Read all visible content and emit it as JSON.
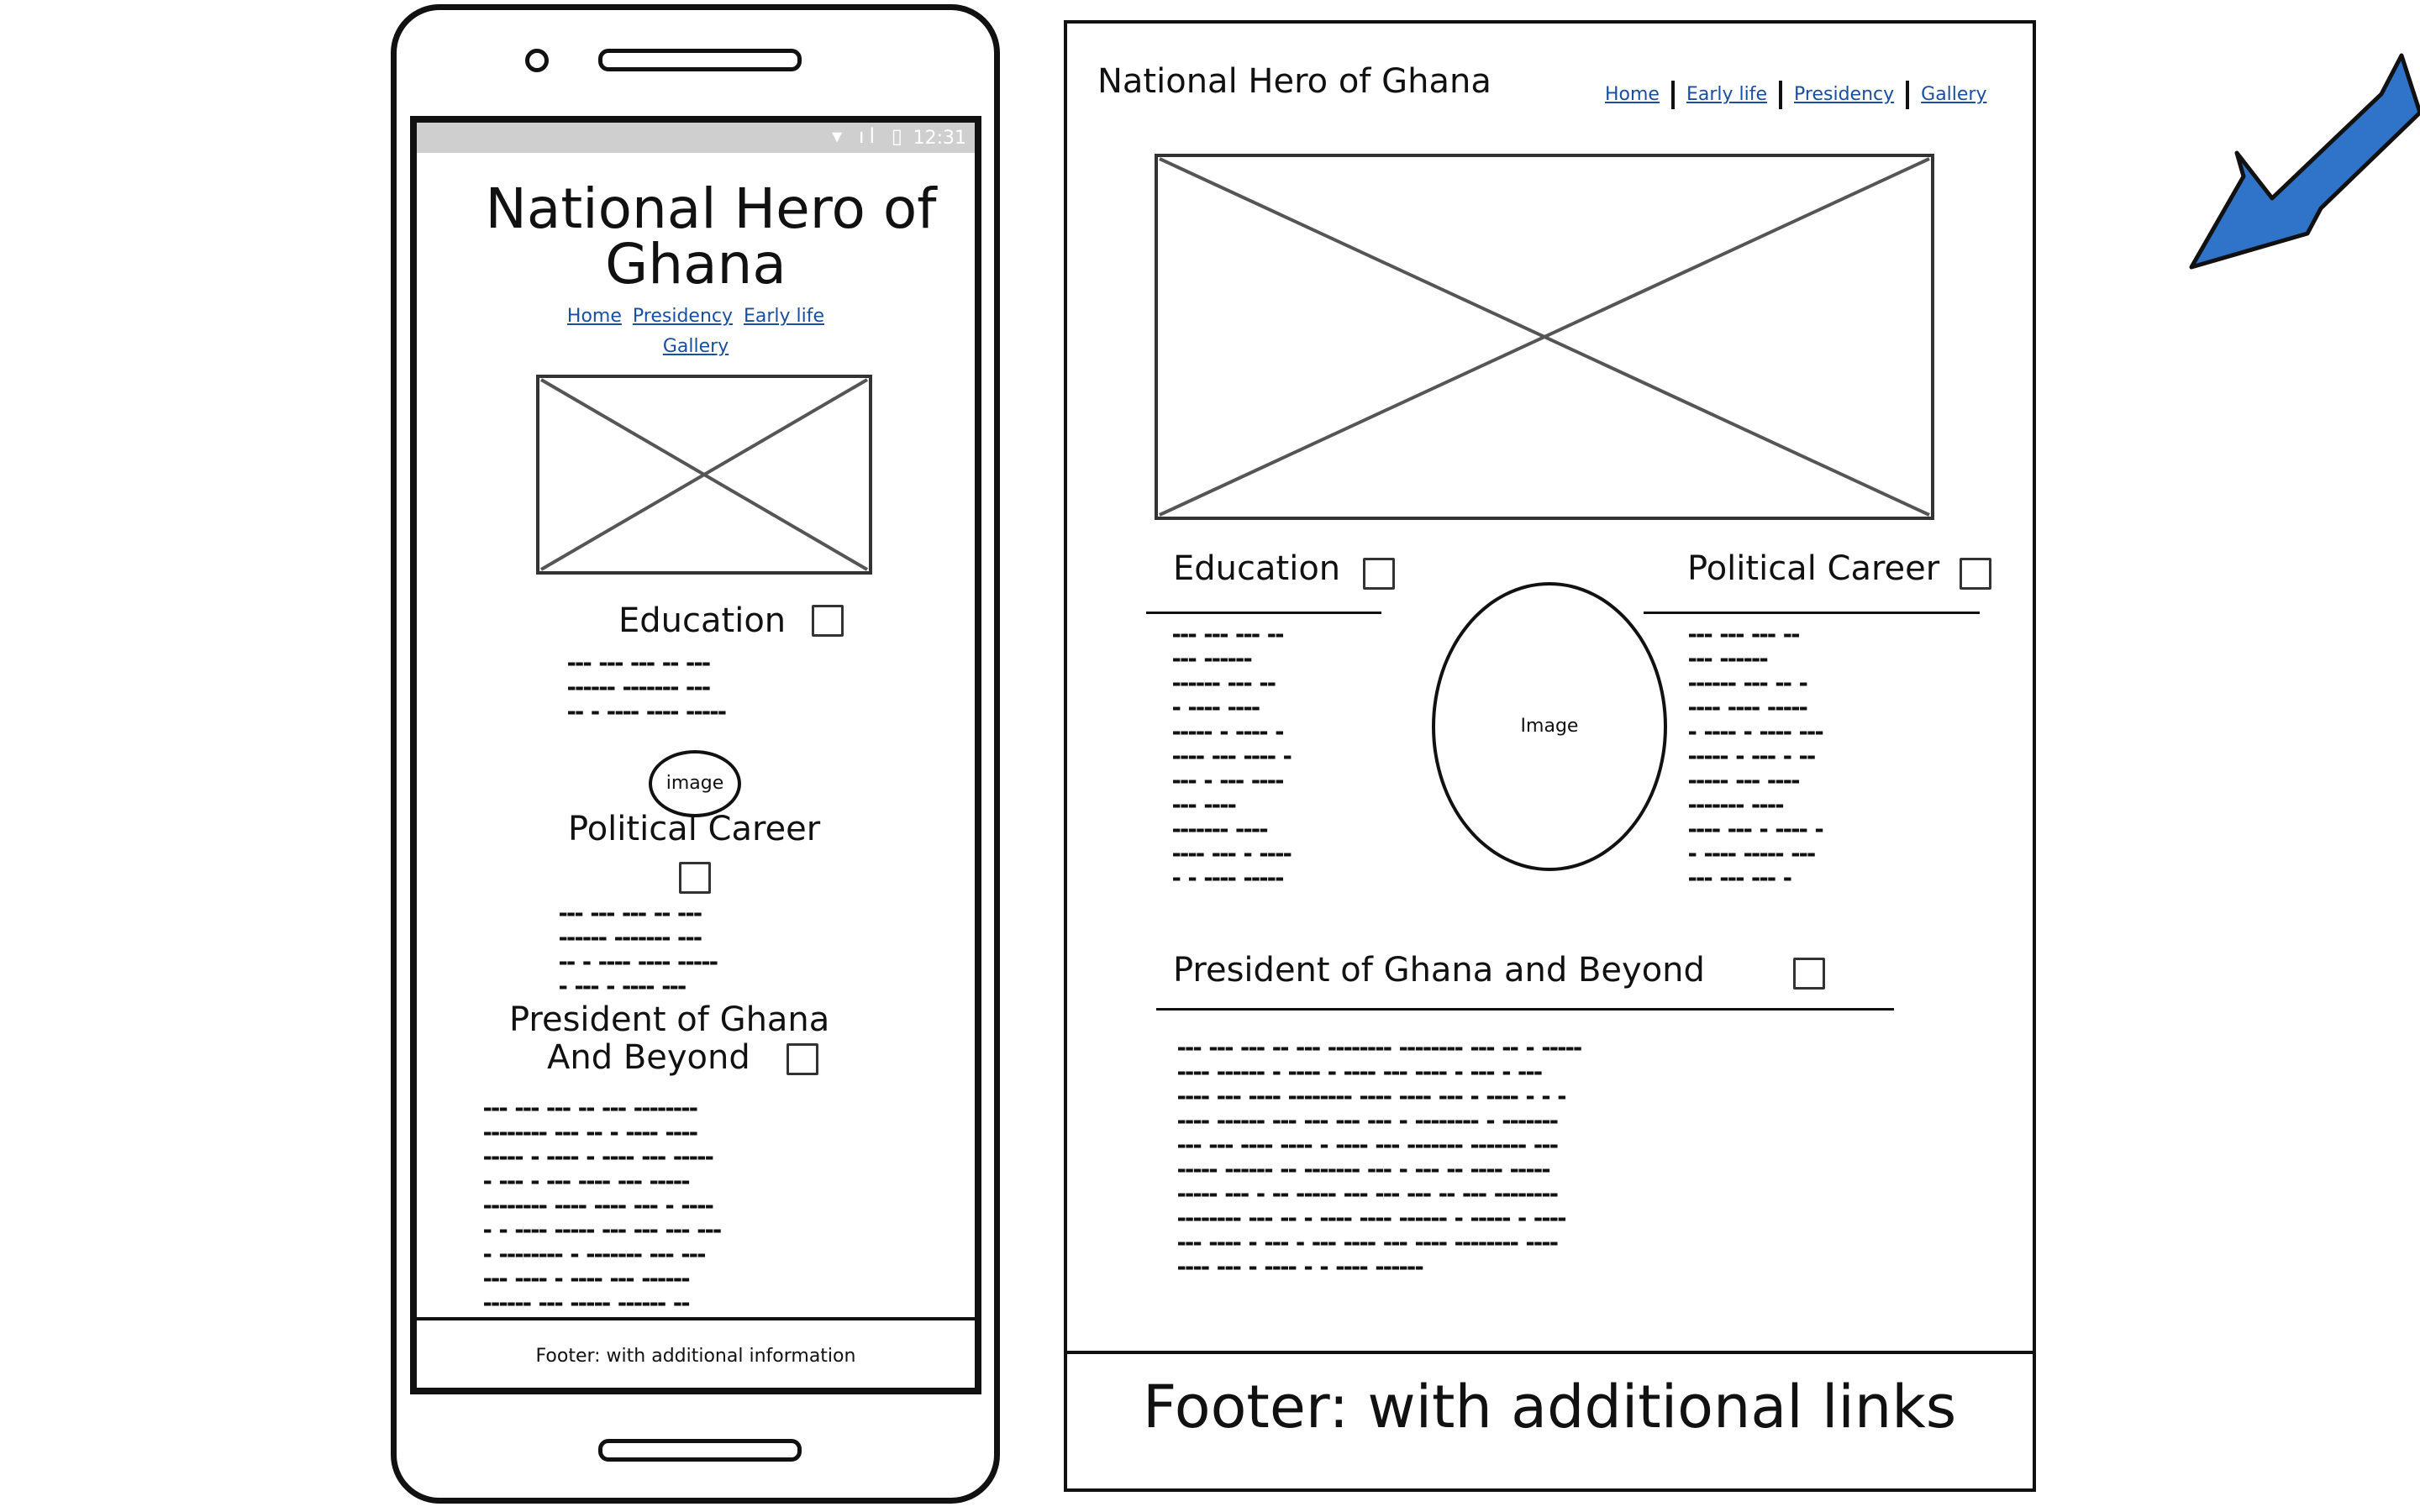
{
  "mobile": {
    "status_time": "12:31",
    "status_icons": "▾ ıl ▯",
    "title_line1": "National Hero of",
    "title_line2": "Ghana",
    "nav": {
      "home": "Home",
      "presidency": "Presidency",
      "early_life": "Early life",
      "gallery": "Gallery"
    },
    "education_heading": "Education",
    "image_label": "image",
    "political_heading": "Political Career",
    "president_line1": "President of Ghana",
    "president_line2": "And Beyond",
    "footer": "Footer: with additional information"
  },
  "desktop": {
    "title": "National Hero of Ghana",
    "nav": {
      "home": "Home",
      "early_life": "Early life",
      "presidency": "Presidency",
      "gallery": "Gallery"
    },
    "education_heading": "Education",
    "political_heading": "Political Career",
    "image_label": "Image",
    "president_heading": "President of Ghana and Beyond",
    "footer": "Footer: with additional links"
  },
  "colors": {
    "link": "#1a4fa0",
    "arrow": "#2f74c9",
    "statusbar": "#cfcfcf"
  },
  "icons": {
    "arrow": "pointer-arrow-icon"
  }
}
